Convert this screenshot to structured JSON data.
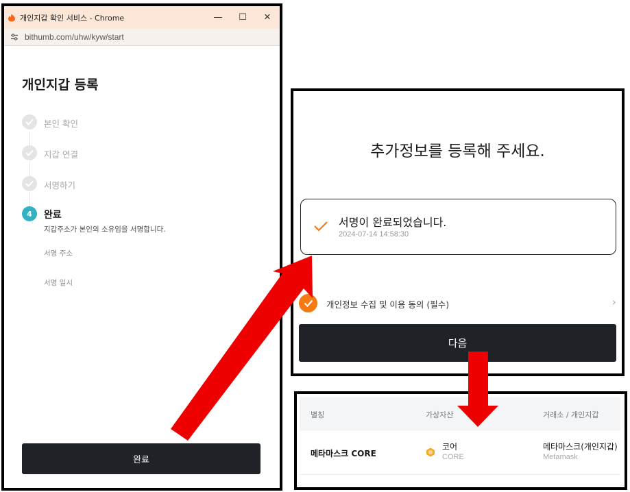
{
  "left_window": {
    "title": "개인지갑 확인 서비스 - Chrome",
    "url": "bithumb.com/uhw/kyw/start",
    "controls": {
      "minimize": "—",
      "maximize": "☐",
      "close": "✕"
    },
    "page_title": "개인지갑 등록",
    "steps": [
      {
        "label": "본인 확인",
        "state": "done"
      },
      {
        "label": "지갑 연결",
        "state": "done"
      },
      {
        "label": "서명하기",
        "state": "done"
      },
      {
        "number": "4",
        "label": "완료",
        "state": "active",
        "description": "지갑주소가 본인의 소유임을 서명합니다."
      }
    ],
    "fields": {
      "address_label": "서명 주소",
      "datetime_label": "서명 일시"
    },
    "done_button": "완료"
  },
  "top_panel": {
    "heading": "추가정보를 등록해 주세요.",
    "signature_message": "서명이 완료되었습니다.",
    "signature_timestamp": "2024-07-14 14:58:30",
    "consent_label": "개인정보 수집 및 이용 동의 (필수)",
    "next_button": "다음"
  },
  "bottom_panel": {
    "headers": {
      "alias": "별칭",
      "asset": "가상자산",
      "wallet": "거래소 / 개인지갑"
    },
    "row": {
      "alias": "메타마스크 CORE",
      "asset_name": "코어",
      "asset_symbol": "CORE",
      "wallet_name": "메타마스크(개인지갑)",
      "wallet_sub": "Metamask"
    }
  },
  "colors": {
    "arrow": "#ee0000",
    "accent_orange": "#f57a13",
    "step_active": "#34b1c3",
    "button_dark": "#1f2227"
  }
}
